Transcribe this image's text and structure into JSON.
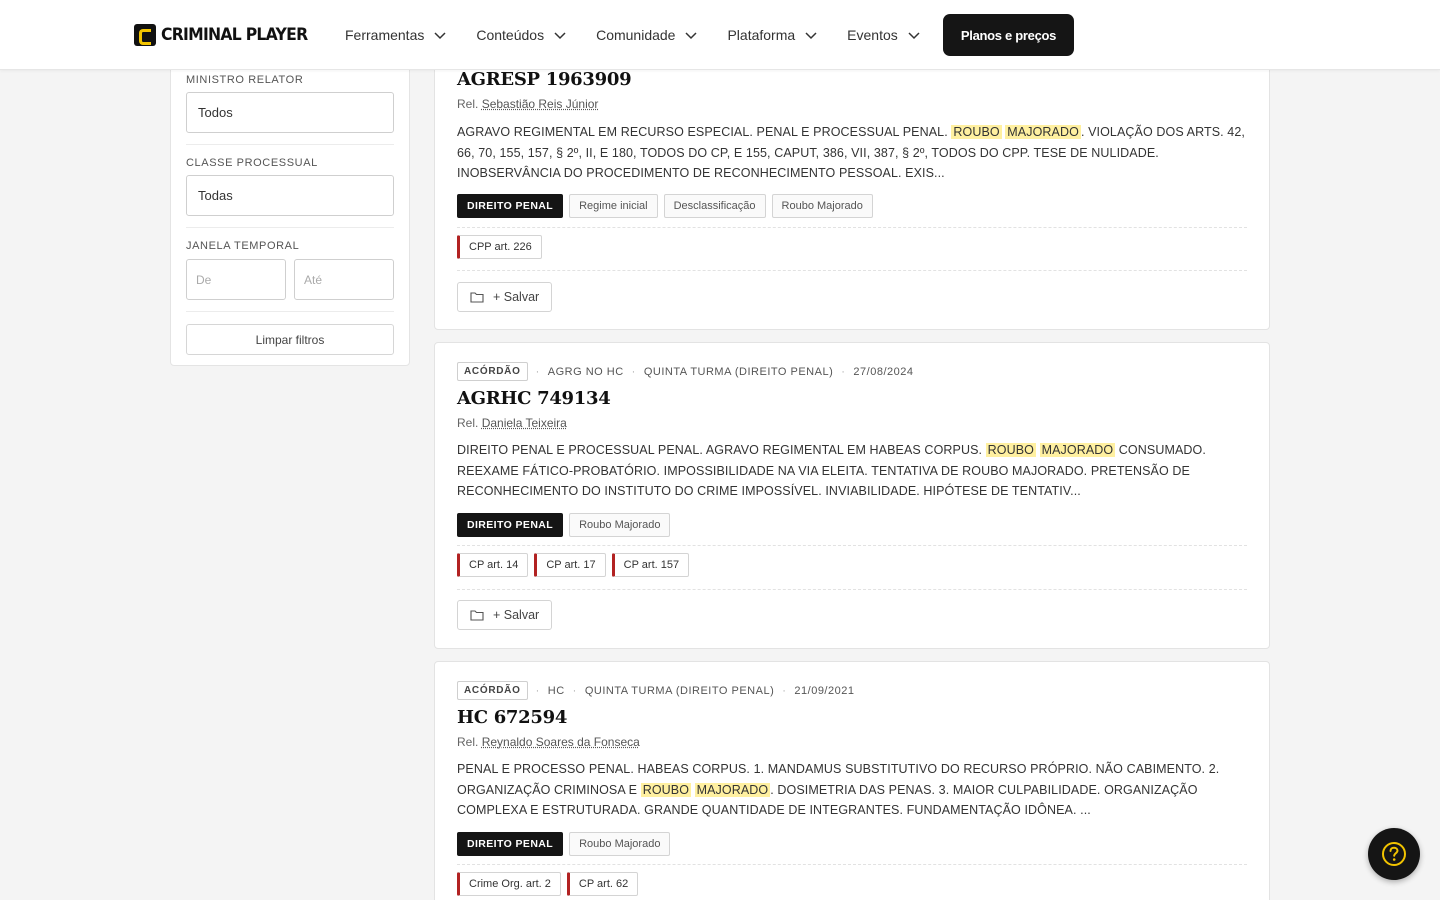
{
  "header": {
    "logo_text": "CRIMINAL PLAYER",
    "nav": [
      "Ferramentas",
      "Conteúdos",
      "Comunidade",
      "Plataforma",
      "Eventos"
    ],
    "plans_button": "Planos e preços"
  },
  "filters": {
    "ministro_label": "MINISTRO RELATOR",
    "ministro_value": "Todos",
    "classe_label": "CLASSE PROCESSUAL",
    "classe_value": "Todas",
    "janela_label": "JANELA TEMPORAL",
    "de_placeholder": "De",
    "ate_placeholder": "Até",
    "clear_button": "Limpar filtros"
  },
  "cards": [
    {
      "title": "AGRESP 1963909",
      "rel_prefix": "Rel.",
      "rel_name": "Sebastião Reis Júnior",
      "summary_before": "AGRAVO REGIMENTAL EM RECURSO ESPECIAL. PENAL E PROCESSUAL PENAL. ",
      "hl1": "ROUBO",
      "hl2": "MAJORADO",
      "summary_after": ". VIOLAÇÃO DOS ARTS. 42, 66, 70, 155, 157, § 2º, II, E 180, TODOS DO CP, E 155, CAPUT, 386, VII, 387, § 2º, TODOS DO CPP. TESE DE NULIDADE. INOBSERVÂNCIA DO PROCEDIMENTO DE RECONHECIMENTO PESSOAL. EXIS...",
      "area": "DIREITO PENAL",
      "tags": [
        "Regime inicial",
        "Desclassificação",
        "Roubo Majorado"
      ],
      "laws": [
        "CPP art. 226"
      ],
      "save": "+ Salvar"
    },
    {
      "kind": "ACÓRDÃO",
      "classe": "AGRG NO HC",
      "turma": "QUINTA TURMA (DIREITO PENAL)",
      "date": "27/08/2024",
      "title": "AGRHC 749134",
      "rel_prefix": "Rel.",
      "rel_name": "Daniela Teixeira",
      "summary_before": "DIREITO PENAL E PROCESSUAL PENAL. AGRAVO REGIMENTAL EM HABEAS CORPUS. ",
      "hl1": "ROUBO",
      "hl2": "MAJORADO",
      "summary_after": " CONSUMADO. REEXAME FÁTICO-PROBATÓRIO. IMPOSSIBILIDADE NA VIA ELEITA. TENTATIVA DE ROUBO MAJORADO. PRETENSÃO DE RECONHECIMENTO DO INSTITUTO DO CRIME IMPOSSÍVEL. INVIABILIDADE. HIPÓTESE DE TENTATIV...",
      "area": "DIREITO PENAL",
      "tags": [
        "Roubo Majorado"
      ],
      "laws": [
        "CP art. 14",
        "CP art. 17",
        "CP art. 157"
      ],
      "save": "+ Salvar"
    },
    {
      "kind": "ACÓRDÃO",
      "classe": "HC",
      "turma": "QUINTA TURMA (DIREITO PENAL)",
      "date": "21/09/2021",
      "title": "HC 672594",
      "rel_prefix": "Rel.",
      "rel_name": "Reynaldo Soares da Fonseca",
      "summary_before": "PENAL E PROCESSO PENAL. HABEAS CORPUS. 1. MANDAMUS SUBSTITUTIVO DO RECURSO PRÓPRIO. NÃO CABIMENTO. 2. ORGANIZAÇÃO CRIMINOSA E ",
      "hl1": "ROUBO",
      "hl2": "MAJORADO",
      "summary_after": ". DOSIMETRIA DAS PENAS. 3. MAIOR CULPABILIDADE. ORGANIZAÇÃO COMPLEXA E ESTRUTURADA. GRANDE QUANTIDADE DE INTEGRANTES. FUNDAMENTAÇÃO IDÔNEA. ...",
      "area": "DIREITO PENAL",
      "tags": [
        "Roubo Majorado"
      ],
      "laws": [
        "Crime Org. art. 2",
        "CP art. 62"
      ]
    }
  ],
  "icons": {
    "chevron": "chevron-down-icon",
    "folder": "folder-icon",
    "help": "question-circle-icon"
  },
  "colors": {
    "accent": "#f2c400",
    "highlight": "#fff0a0",
    "law_border": "#b22222",
    "dark": "#151515"
  }
}
